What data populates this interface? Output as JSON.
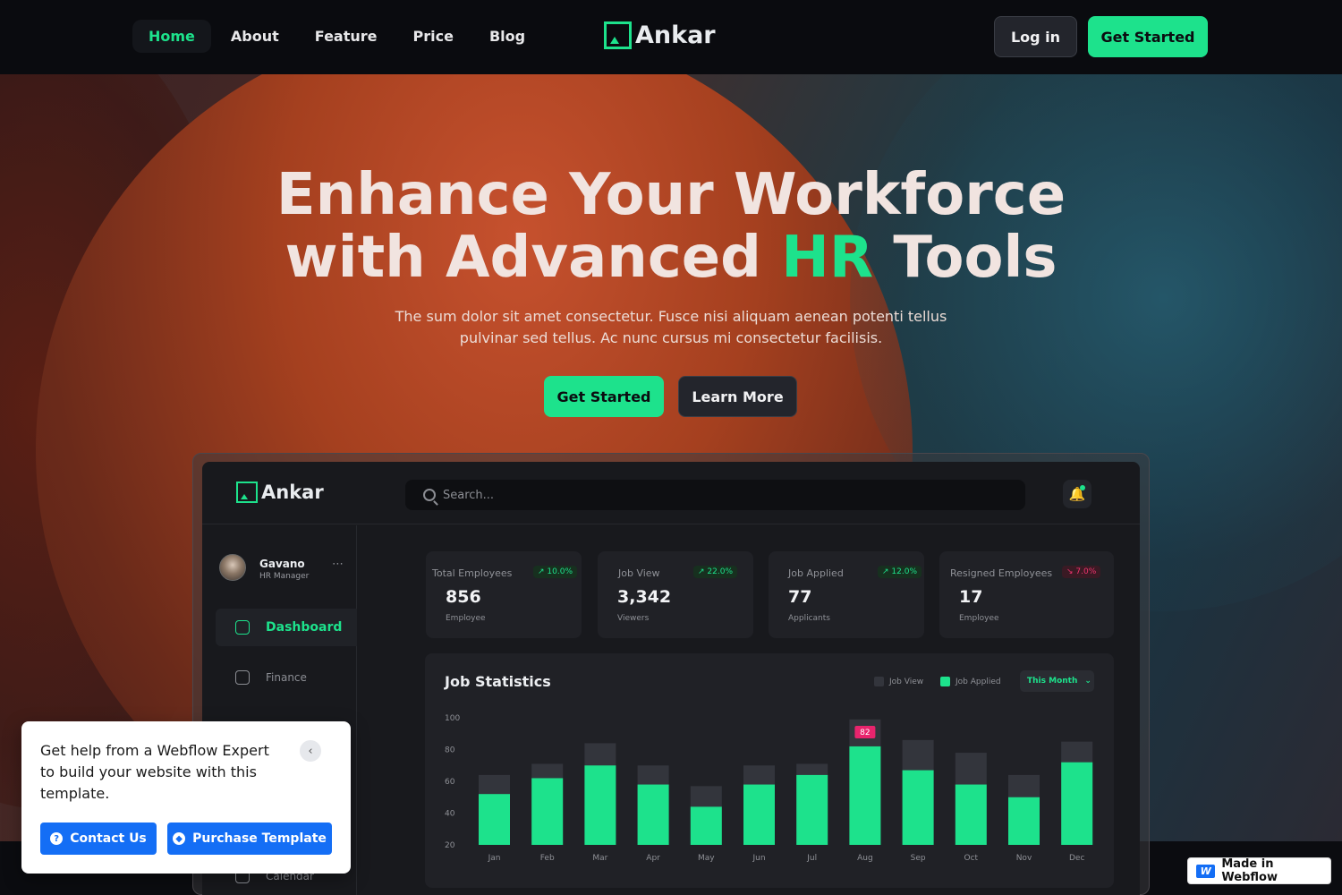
{
  "nav": {
    "links": [
      {
        "label": "Home",
        "active": true
      },
      {
        "label": "About"
      },
      {
        "label": "Feature"
      },
      {
        "label": "Price"
      },
      {
        "label": "Blog"
      }
    ],
    "brand": "Ankar",
    "login_label": "Log in",
    "cta_label": "Get Started"
  },
  "hero": {
    "title_line1": "Enhance Your Workforce",
    "title_line2_pre": "with Advanced ",
    "title_line2_accent": "HR",
    "title_line2_post": " Tools",
    "subtitle": "The sum dolor sit amet consectetur. Fusce nisi aliquam aenean potenti tellus pulvinar sed tellus. Ac nunc cursus mi consectetur facilisis.",
    "primary_label": "Get Started",
    "secondary_label": "Learn More"
  },
  "dashboard": {
    "brand": "Ankar",
    "search_placeholder": "Search...",
    "user": {
      "name": "Gavano",
      "role": "HR Manager",
      "more": "⋯"
    },
    "sidebar": [
      {
        "label": "Dashboard",
        "active": true
      },
      {
        "label": "Finance"
      },
      {
        "label": "Calendar"
      }
    ],
    "stats": [
      {
        "label": "Total Employees",
        "badge": "10.0%",
        "trend": "up",
        "value": "856",
        "unit": "Employee"
      },
      {
        "label": "Job View",
        "badge": "22.0%",
        "trend": "up",
        "value": "3,342",
        "unit": "Viewers"
      },
      {
        "label": "Job Applied",
        "badge": "12.0%",
        "trend": "up",
        "value": "77",
        "unit": "Applicants"
      },
      {
        "label": "Resigned Employees",
        "badge": "7.0%",
        "trend": "down",
        "value": "17",
        "unit": "Employee"
      }
    ],
    "chart_title": "Job Statistics",
    "legend": [
      "Job View",
      "Job Applied"
    ],
    "period": "This Month",
    "colors": {
      "accent": "#1de28c",
      "job_view": "#33353c",
      "highlight": "#e8246d"
    }
  },
  "chart_data": {
    "type": "bar",
    "title": "Job Statistics",
    "categories": [
      "Jan",
      "Feb",
      "Mar",
      "Apr",
      "May",
      "Jun",
      "Jul",
      "Aug",
      "Sep",
      "Oct",
      "Nov",
      "Dec"
    ],
    "series": [
      {
        "name": "Job View",
        "values": [
          64,
          71,
          84,
          70,
          57,
          70,
          71,
          99,
          86,
          78,
          64,
          85
        ]
      },
      {
        "name": "Job Applied",
        "values": [
          52,
          62,
          70,
          58,
          44,
          58,
          64,
          82,
          67,
          58,
          50,
          72
        ]
      }
    ],
    "annotation": {
      "category": "Aug",
      "label": "82"
    },
    "ylim": [
      20,
      100
    ],
    "yticks": [
      20,
      40,
      60,
      80,
      100
    ],
    "legend_position": "top-right",
    "grid": false
  },
  "help": {
    "text": "Get help from a Webflow Expert to build your website with this template.",
    "collapse_icon": "‹",
    "contact_label": "Contact Us",
    "purchase_label": "Purchase Template"
  },
  "badge": {
    "label": "Made in Webflow"
  }
}
